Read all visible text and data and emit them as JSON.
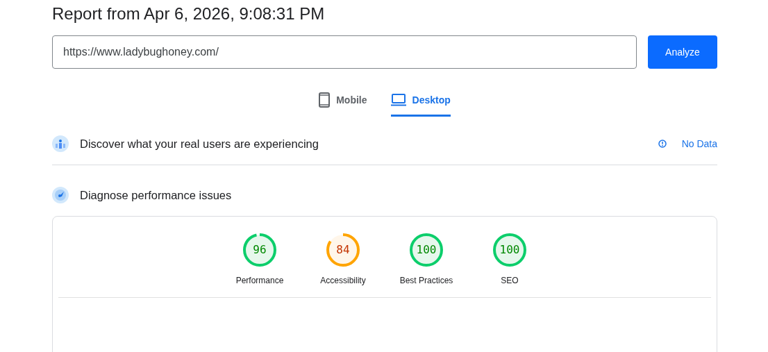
{
  "title": "Report from Apr 6, 2026, 9:08:31 PM",
  "url_field": {
    "value": "https://www.ladybughoney.com/"
  },
  "analyze_button": "Analyze",
  "tabs": [
    {
      "label": "Mobile",
      "kind": "phone",
      "selected": false
    },
    {
      "label": "Desktop",
      "kind": "laptop",
      "selected": true
    }
  ],
  "field_section": {
    "title": "Discover what your real users are experiencing",
    "status": "No Data"
  },
  "lab_section": {
    "title": "Diagnose performance issues"
  },
  "gauges": [
    {
      "score": "96",
      "label": "Performance",
      "color": "#0cce6b"
    },
    {
      "score": "84",
      "label": "Accessibility",
      "color": "#ffa400"
    },
    {
      "score": "100",
      "label": "Best Practices",
      "color": "#0cce6b"
    },
    {
      "score": "100",
      "label": "SEO",
      "color": "#0cce6b"
    }
  ]
}
